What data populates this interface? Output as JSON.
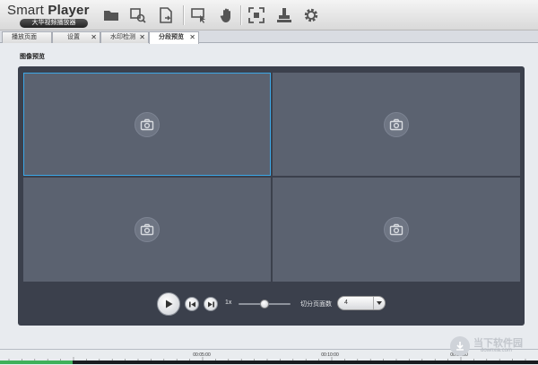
{
  "app": {
    "title_light": "Smart",
    "title_bold": "Player",
    "subtitle": "大华视频播放器"
  },
  "toolbar": {
    "tools": [
      {
        "icon": "folder-icon",
        "name": "open-folder"
      },
      {
        "icon": "search-folder-icon",
        "name": "search-files"
      },
      {
        "icon": "file-convert-icon",
        "name": "convert-file"
      },
      {
        "icon": "screen-pointer-icon",
        "name": "smart-search"
      },
      {
        "icon": "hand-icon",
        "name": "pan"
      },
      {
        "icon": "fullscreen-icon",
        "name": "fullscreen"
      },
      {
        "icon": "stamp-icon",
        "name": "watermark"
      },
      {
        "icon": "gear-icon",
        "name": "settings"
      }
    ]
  },
  "tabs": [
    {
      "label": "播放页面",
      "closable": false,
      "active": false
    },
    {
      "label": "设置",
      "closable": true,
      "active": false
    },
    {
      "label": "水印检测",
      "closable": true,
      "active": false
    },
    {
      "label": "分段预览",
      "closable": true,
      "active": true
    }
  ],
  "content": {
    "section_title": "图像预览"
  },
  "grid": {
    "cells": [
      {
        "selected": true,
        "icon": "camera-icon"
      },
      {
        "selected": false,
        "icon": "camera-icon"
      },
      {
        "selected": false,
        "icon": "camera-icon"
      },
      {
        "selected": false,
        "icon": "camera-icon"
      }
    ]
  },
  "controls": {
    "speed_label": "1x",
    "speed_slider_value": 0.5,
    "split_label": "切分页面数",
    "split_value": "4"
  },
  "timeline": {
    "ticks": [
      "00:05:00",
      "00:10:00",
      "00:15:00"
    ],
    "progress": 0.135
  },
  "watermark": {
    "title": "当下软件园",
    "url": "downxia.com"
  },
  "colors": {
    "selected_outline": "#3ca7e6",
    "panel_bg": "#3b404c",
    "cell_bg": "#5b6270",
    "progress": "#3fb05a"
  }
}
